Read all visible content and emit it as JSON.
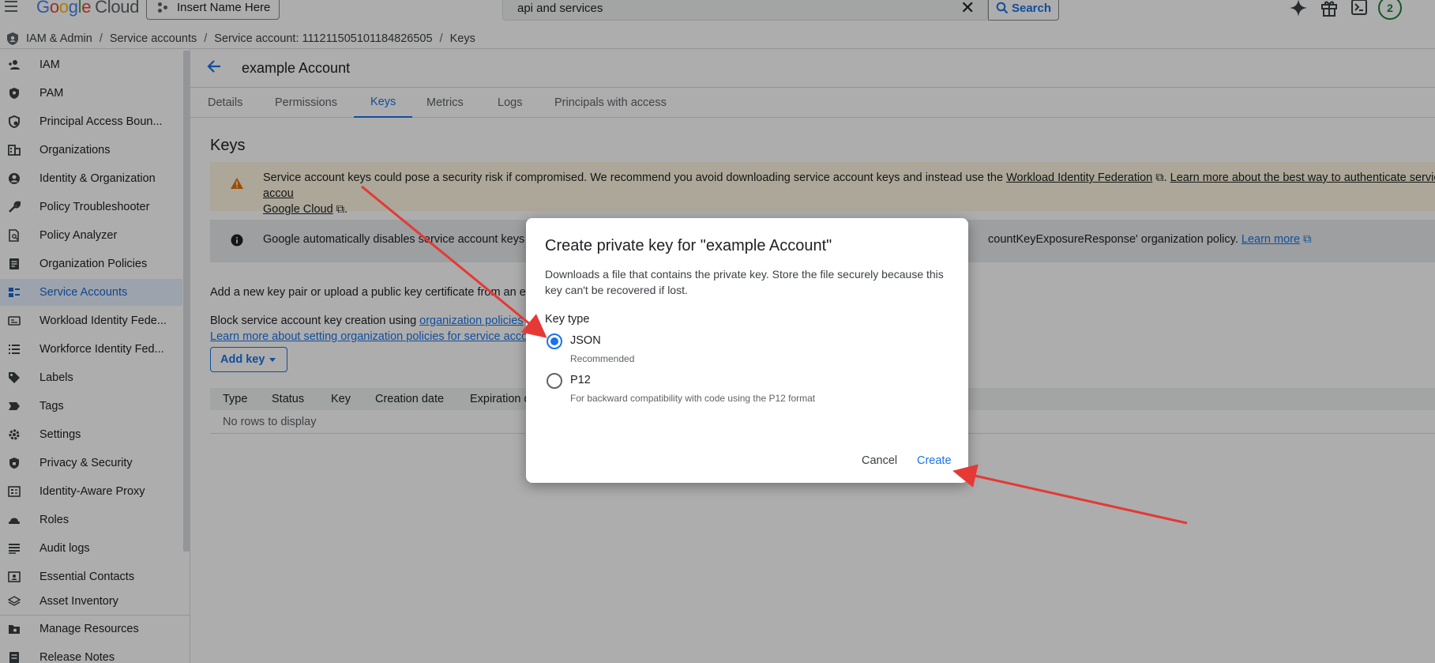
{
  "topbar": {
    "logo_google": [
      "G",
      "o",
      "o",
      "g",
      "l",
      "e"
    ],
    "logo_cloud": "Cloud",
    "project_name": "Insert Name Here",
    "search_value": "api and services",
    "search_button": "Search",
    "notification_count": "2"
  },
  "breadcrumb": {
    "items": [
      "IAM & Admin",
      "Service accounts",
      "Service account: 111211505101184826505",
      "Keys"
    ]
  },
  "sidebar": {
    "items": [
      {
        "label": "IAM",
        "icon": "person-add-icon"
      },
      {
        "label": "PAM",
        "icon": "shield-icon"
      },
      {
        "label": "Principal Access Boun...",
        "icon": "policy-boundary-icon"
      },
      {
        "label": "Organizations",
        "icon": "building-icon"
      },
      {
        "label": "Identity & Organization",
        "icon": "account-circle-icon"
      },
      {
        "label": "Policy Troubleshooter",
        "icon": "wrench-icon"
      },
      {
        "label": "Policy Analyzer",
        "icon": "document-search-icon"
      },
      {
        "label": "Organization Policies",
        "icon": "document-icon"
      },
      {
        "label": "Service Accounts",
        "icon": "service-account-icon",
        "active": true
      },
      {
        "label": "Workload Identity Fede...",
        "icon": "id-card-icon"
      },
      {
        "label": "Workforce Identity Fed...",
        "icon": "list-icon"
      },
      {
        "label": "Labels",
        "icon": "tag-icon"
      },
      {
        "label": "Tags",
        "icon": "label-arrow-icon"
      },
      {
        "label": "Settings",
        "icon": "gear-icon"
      },
      {
        "label": "Privacy & Security",
        "icon": "shield-lock-icon"
      },
      {
        "label": "Identity-Aware Proxy",
        "icon": "proxy-icon"
      },
      {
        "label": "Roles",
        "icon": "hat-icon"
      },
      {
        "label": "Audit logs",
        "icon": "lines-icon"
      },
      {
        "label": "Essential Contacts",
        "icon": "contact-card-icon"
      },
      {
        "label": "Asset Inventory",
        "icon": "layers-icon"
      }
    ],
    "bottom_items": [
      {
        "label": "Manage Resources",
        "icon": "folder-gear-icon"
      },
      {
        "label": "Release Notes",
        "icon": "notes-icon"
      }
    ]
  },
  "page": {
    "title": "example Account",
    "tabs": [
      "Details",
      "Permissions",
      "Keys",
      "Metrics",
      "Logs",
      "Principals with access"
    ],
    "active_tab": "Keys",
    "section_title": "Keys",
    "warning": {
      "text_before": "Service account keys could pose a security risk if compromised. We recommend you avoid downloading service account keys and instead use the ",
      "link1": "Workload Identity Federation",
      "sep": ". ",
      "link2": "Learn more about the best way to authenticate service accou",
      "link3": "Google Cloud",
      "text_end": "."
    },
    "info": {
      "text_left": "Google automatically disables service account keys d",
      "text_right": "countKeyExposureResponse' organization policy. ",
      "link": "Learn more"
    },
    "para1": "Add a new key pair or upload a public key certificate from an exis",
    "para2_before": "Block service account key creation using ",
    "para2_link": "organization policies",
    "para3_link": "Learn more about setting organization policies for service accou",
    "add_key": "Add key",
    "table_headers": [
      "Type",
      "Status",
      "Key",
      "Creation date",
      "Expiration d"
    ],
    "table_empty": "No rows to display"
  },
  "dialog": {
    "title": "Create private key for \"example Account\"",
    "description": "Downloads a file that contains the private key. Store the file securely because this key can't be recovered if lost.",
    "key_type_label": "Key type",
    "options": [
      {
        "label": "JSON",
        "help": "Recommended",
        "checked": true
      },
      {
        "label": "P12",
        "help": "For backward compatibility with code using the P12 format",
        "checked": false
      }
    ],
    "cancel": "Cancel",
    "create": "Create"
  },
  "colors": {
    "accent": "#1a73e8",
    "annotation_arrow": "#e53935",
    "warning_bg": "#fef7e0",
    "warning_icon": "#e37400"
  }
}
